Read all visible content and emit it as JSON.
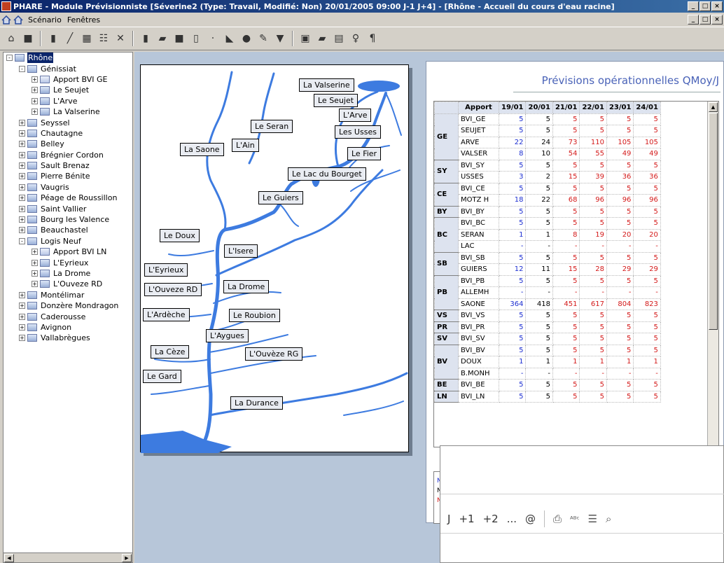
{
  "window": {
    "title": "PHARE - Module Prévisionniste [Séverine2 (Type: Travail, Modifié: Non) 20/01/2005 09:00 J-1 J+4] - [Rhône - Accueil du cours d'eau racine]",
    "btn_min": "_",
    "btn_max": "□",
    "btn_close": "×"
  },
  "menu": {
    "items": [
      "Scénario",
      "Fenêtres"
    ]
  },
  "tree": {
    "root": "Rhône",
    "items": [
      {
        "label": "Génissiat",
        "level": 1,
        "exp": "-",
        "icon": "folder-icon"
      },
      {
        "label": "Apport BVI GE",
        "level": 2,
        "exp": "+",
        "icon": "subfolder-icon"
      },
      {
        "label": "Le Seujet",
        "level": 2,
        "exp": "+",
        "icon": "river-icon"
      },
      {
        "label": "L'Arve",
        "level": 2,
        "exp": "+",
        "icon": "river-icon"
      },
      {
        "label": "La Valserine",
        "level": 2,
        "exp": "+",
        "icon": "river-icon"
      },
      {
        "label": "Seyssel",
        "level": 1,
        "exp": "+",
        "icon": "folder-icon"
      },
      {
        "label": "Chautagne",
        "level": 1,
        "exp": "+",
        "icon": "folder-icon"
      },
      {
        "label": "Belley",
        "level": 1,
        "exp": "+",
        "icon": "folder-icon"
      },
      {
        "label": "Brégnier Cordon",
        "level": 1,
        "exp": "+",
        "icon": "folder-icon"
      },
      {
        "label": "Sault Brenaz",
        "level": 1,
        "exp": "+",
        "icon": "folder-icon"
      },
      {
        "label": "Pierre Bénite",
        "level": 1,
        "exp": "+",
        "icon": "folder-icon"
      },
      {
        "label": "Vaugris",
        "level": 1,
        "exp": "+",
        "icon": "folder-icon"
      },
      {
        "label": "Péage de Roussillon",
        "level": 1,
        "exp": "+",
        "icon": "folder-icon"
      },
      {
        "label": "Saint Vallier",
        "level": 1,
        "exp": "+",
        "icon": "folder-icon"
      },
      {
        "label": "Bourg les Valence",
        "level": 1,
        "exp": "+",
        "icon": "folder-icon"
      },
      {
        "label": "Beauchastel",
        "level": 1,
        "exp": "+",
        "icon": "folder-icon"
      },
      {
        "label": "Logis Neuf",
        "level": 1,
        "exp": "-",
        "icon": "folder-icon"
      },
      {
        "label": "Apport BVI LN",
        "level": 2,
        "exp": "+",
        "icon": "subfolder-icon"
      },
      {
        "label": "L'Eyrieux",
        "level": 2,
        "exp": "+",
        "icon": "river-icon"
      },
      {
        "label": "La Drome",
        "level": 2,
        "exp": "+",
        "icon": "river-icon"
      },
      {
        "label": "L'Ouveze RD",
        "level": 2,
        "exp": "+",
        "icon": "river-icon"
      },
      {
        "label": "Montélimar",
        "level": 1,
        "exp": "+",
        "icon": "folder-icon"
      },
      {
        "label": "Donzère Mondragon",
        "level": 1,
        "exp": "+",
        "icon": "folder-icon"
      },
      {
        "label": "Caderousse",
        "level": 1,
        "exp": "+",
        "icon": "folder-icon"
      },
      {
        "label": "Avignon",
        "level": 1,
        "exp": "+",
        "icon": "folder-icon"
      },
      {
        "label": "Vallabrègues",
        "level": 1,
        "exp": "+",
        "icon": "folder-icon"
      }
    ]
  },
  "map": {
    "labels": [
      {
        "text": "La Valserine",
        "name": "map-label-la-valserine"
      },
      {
        "text": "Le Seujet",
        "name": "map-label-le-seujet"
      },
      {
        "text": "L'Arve",
        "name": "map-label-l-arve"
      },
      {
        "text": "Les Usses",
        "name": "map-label-les-usses"
      },
      {
        "text": "Le Fier",
        "name": "map-label-le-fier"
      },
      {
        "text": "Le Seran",
        "name": "map-label-le-seran"
      },
      {
        "text": "L'Ain",
        "name": "map-label-l-ain"
      },
      {
        "text": "La Saone",
        "name": "map-label-la-saone"
      },
      {
        "text": "Le Lac du Bourget",
        "name": "map-label-le-lac-du-bourget"
      },
      {
        "text": "Le Guiers",
        "name": "map-label-le-guiers"
      },
      {
        "text": "Le Doux",
        "name": "map-label-le-doux"
      },
      {
        "text": "L'Isere",
        "name": "map-label-l-isere"
      },
      {
        "text": "L'Eyrieux",
        "name": "map-label-l-eyrieux"
      },
      {
        "text": "L'Ouveze RD",
        "name": "map-label-l-ouveze-rd"
      },
      {
        "text": "La Drome",
        "name": "map-label-la-drome"
      },
      {
        "text": "L'Ardèche",
        "name": "map-label-l-ardeche"
      },
      {
        "text": "Le Roubion",
        "name": "map-label-le-roubion"
      },
      {
        "text": "L'Aygues",
        "name": "map-label-l-aygues"
      },
      {
        "text": "La Cèze",
        "name": "map-label-la-ceze"
      },
      {
        "text": "L'Ouvèze RG",
        "name": "map-label-l-ouveze-rg"
      },
      {
        "text": "Le Gard",
        "name": "map-label-le-gard"
      },
      {
        "text": "La Durance",
        "name": "map-label-la-durance"
      }
    ],
    "river_color": "#3d7be0",
    "sea_color": "#3d7be0"
  },
  "forecast": {
    "title": "Prévisions opérationnelles QMoy/J",
    "header": [
      "Apport",
      "19/01",
      "20/01",
      "21/01",
      "22/01",
      "23/01",
      "24/01"
    ],
    "groups": [
      {
        "code": "GE",
        "rows": [
          {
            "name": "BVI_GE",
            "values": [
              "5",
              "5",
              "5",
              "5",
              "5",
              "5"
            ]
          },
          {
            "name": "SEUJET",
            "values": [
              "5",
              "5",
              "5",
              "5",
              "5",
              "5"
            ]
          },
          {
            "name": "ARVE",
            "values": [
              "22",
              "24",
              "73",
              "110",
              "105",
              "105"
            ]
          },
          {
            "name": "VALSER",
            "values": [
              "8",
              "10",
              "54",
              "55",
              "49",
              "49"
            ]
          }
        ]
      },
      {
        "code": "SY",
        "rows": [
          {
            "name": "BVI_SY",
            "values": [
              "5",
              "5",
              "5",
              "5",
              "5",
              "5"
            ]
          },
          {
            "name": "USSES",
            "values": [
              "3",
              "2",
              "15",
              "39",
              "36",
              "36"
            ]
          }
        ]
      },
      {
        "code": "CE",
        "rows": [
          {
            "name": "BVI_CE",
            "values": [
              "5",
              "5",
              "5",
              "5",
              "5",
              "5"
            ]
          },
          {
            "name": "MOTZ H",
            "values": [
              "18",
              "22",
              "68",
              "96",
              "96",
              "96"
            ]
          }
        ]
      },
      {
        "code": "BY",
        "rows": [
          {
            "name": "BVI_BY",
            "values": [
              "5",
              "5",
              "5",
              "5",
              "5",
              "5"
            ]
          }
        ]
      },
      {
        "code": "BC",
        "rows": [
          {
            "name": "BVI_BC",
            "values": [
              "5",
              "5",
              "5",
              "5",
              "5",
              "5"
            ]
          },
          {
            "name": "SERAN",
            "values": [
              "1",
              "1",
              "8",
              "19",
              "20",
              "20"
            ]
          },
          {
            "name": "LAC",
            "values": [
              "-",
              "-",
              "-",
              "-",
              "-",
              "-"
            ]
          }
        ]
      },
      {
        "code": "SB",
        "rows": [
          {
            "name": "BVI_SB",
            "values": [
              "5",
              "5",
              "5",
              "5",
              "5",
              "5"
            ]
          },
          {
            "name": "GUIERS",
            "values": [
              "12",
              "11",
              "15",
              "28",
              "29",
              "29"
            ]
          }
        ]
      },
      {
        "code": "PB",
        "rows": [
          {
            "name": "BVI_PB",
            "values": [
              "5",
              "5",
              "5",
              "5",
              "5",
              "5"
            ]
          },
          {
            "name": "ALLEMH",
            "values": [
              "-",
              "-",
              "-",
              "-",
              "-",
              "-"
            ]
          },
          {
            "name": "SAONE",
            "values": [
              "364",
              "418",
              "451",
              "617",
              "804",
              "823"
            ]
          }
        ]
      },
      {
        "code": "VS",
        "rows": [
          {
            "name": "BVI_VS",
            "values": [
              "5",
              "5",
              "5",
              "5",
              "5",
              "5"
            ]
          }
        ]
      },
      {
        "code": "PR",
        "rows": [
          {
            "name": "BVI_PR",
            "values": [
              "5",
              "5",
              "5",
              "5",
              "5",
              "5"
            ]
          }
        ]
      },
      {
        "code": "SV",
        "rows": [
          {
            "name": "BVI_SV",
            "values": [
              "5",
              "5",
              "5",
              "5",
              "5",
              "5"
            ]
          }
        ]
      },
      {
        "code": "BV",
        "rows": [
          {
            "name": "BVI_BV",
            "values": [
              "5",
              "5",
              "5",
              "5",
              "5",
              "5"
            ]
          },
          {
            "name": "DOUX",
            "values": [
              "1",
              "1",
              "1",
              "1",
              "1",
              "1"
            ]
          },
          {
            "name": "B.MONH",
            "values": [
              "-",
              "-",
              "-",
              "-",
              "-",
              "-"
            ]
          }
        ]
      },
      {
        "code": "BE",
        "rows": [
          {
            "name": "BVI_BE",
            "values": [
              "5",
              "5",
              "5",
              "5",
              "5",
              "5"
            ]
          }
        ]
      },
      {
        "code": "LN",
        "rows": [
          {
            "name": "BVI_LN",
            "values": [
              "5",
              "5",
              "5",
              "5",
              "5",
              "5"
            ]
          }
        ]
      }
    ],
    "column_colors": [
      "blue",
      "black",
      "red",
      "red",
      "red",
      "red"
    ],
    "legend_letters": [
      "N",
      "N",
      "N"
    ]
  },
  "overlay": {
    "toolbar": [
      "J",
      "+1",
      "+2",
      "...",
      "@"
    ],
    "icons": [
      "printer-icon",
      "spellcheck-icon",
      "list-icon",
      "preview-icon"
    ]
  }
}
